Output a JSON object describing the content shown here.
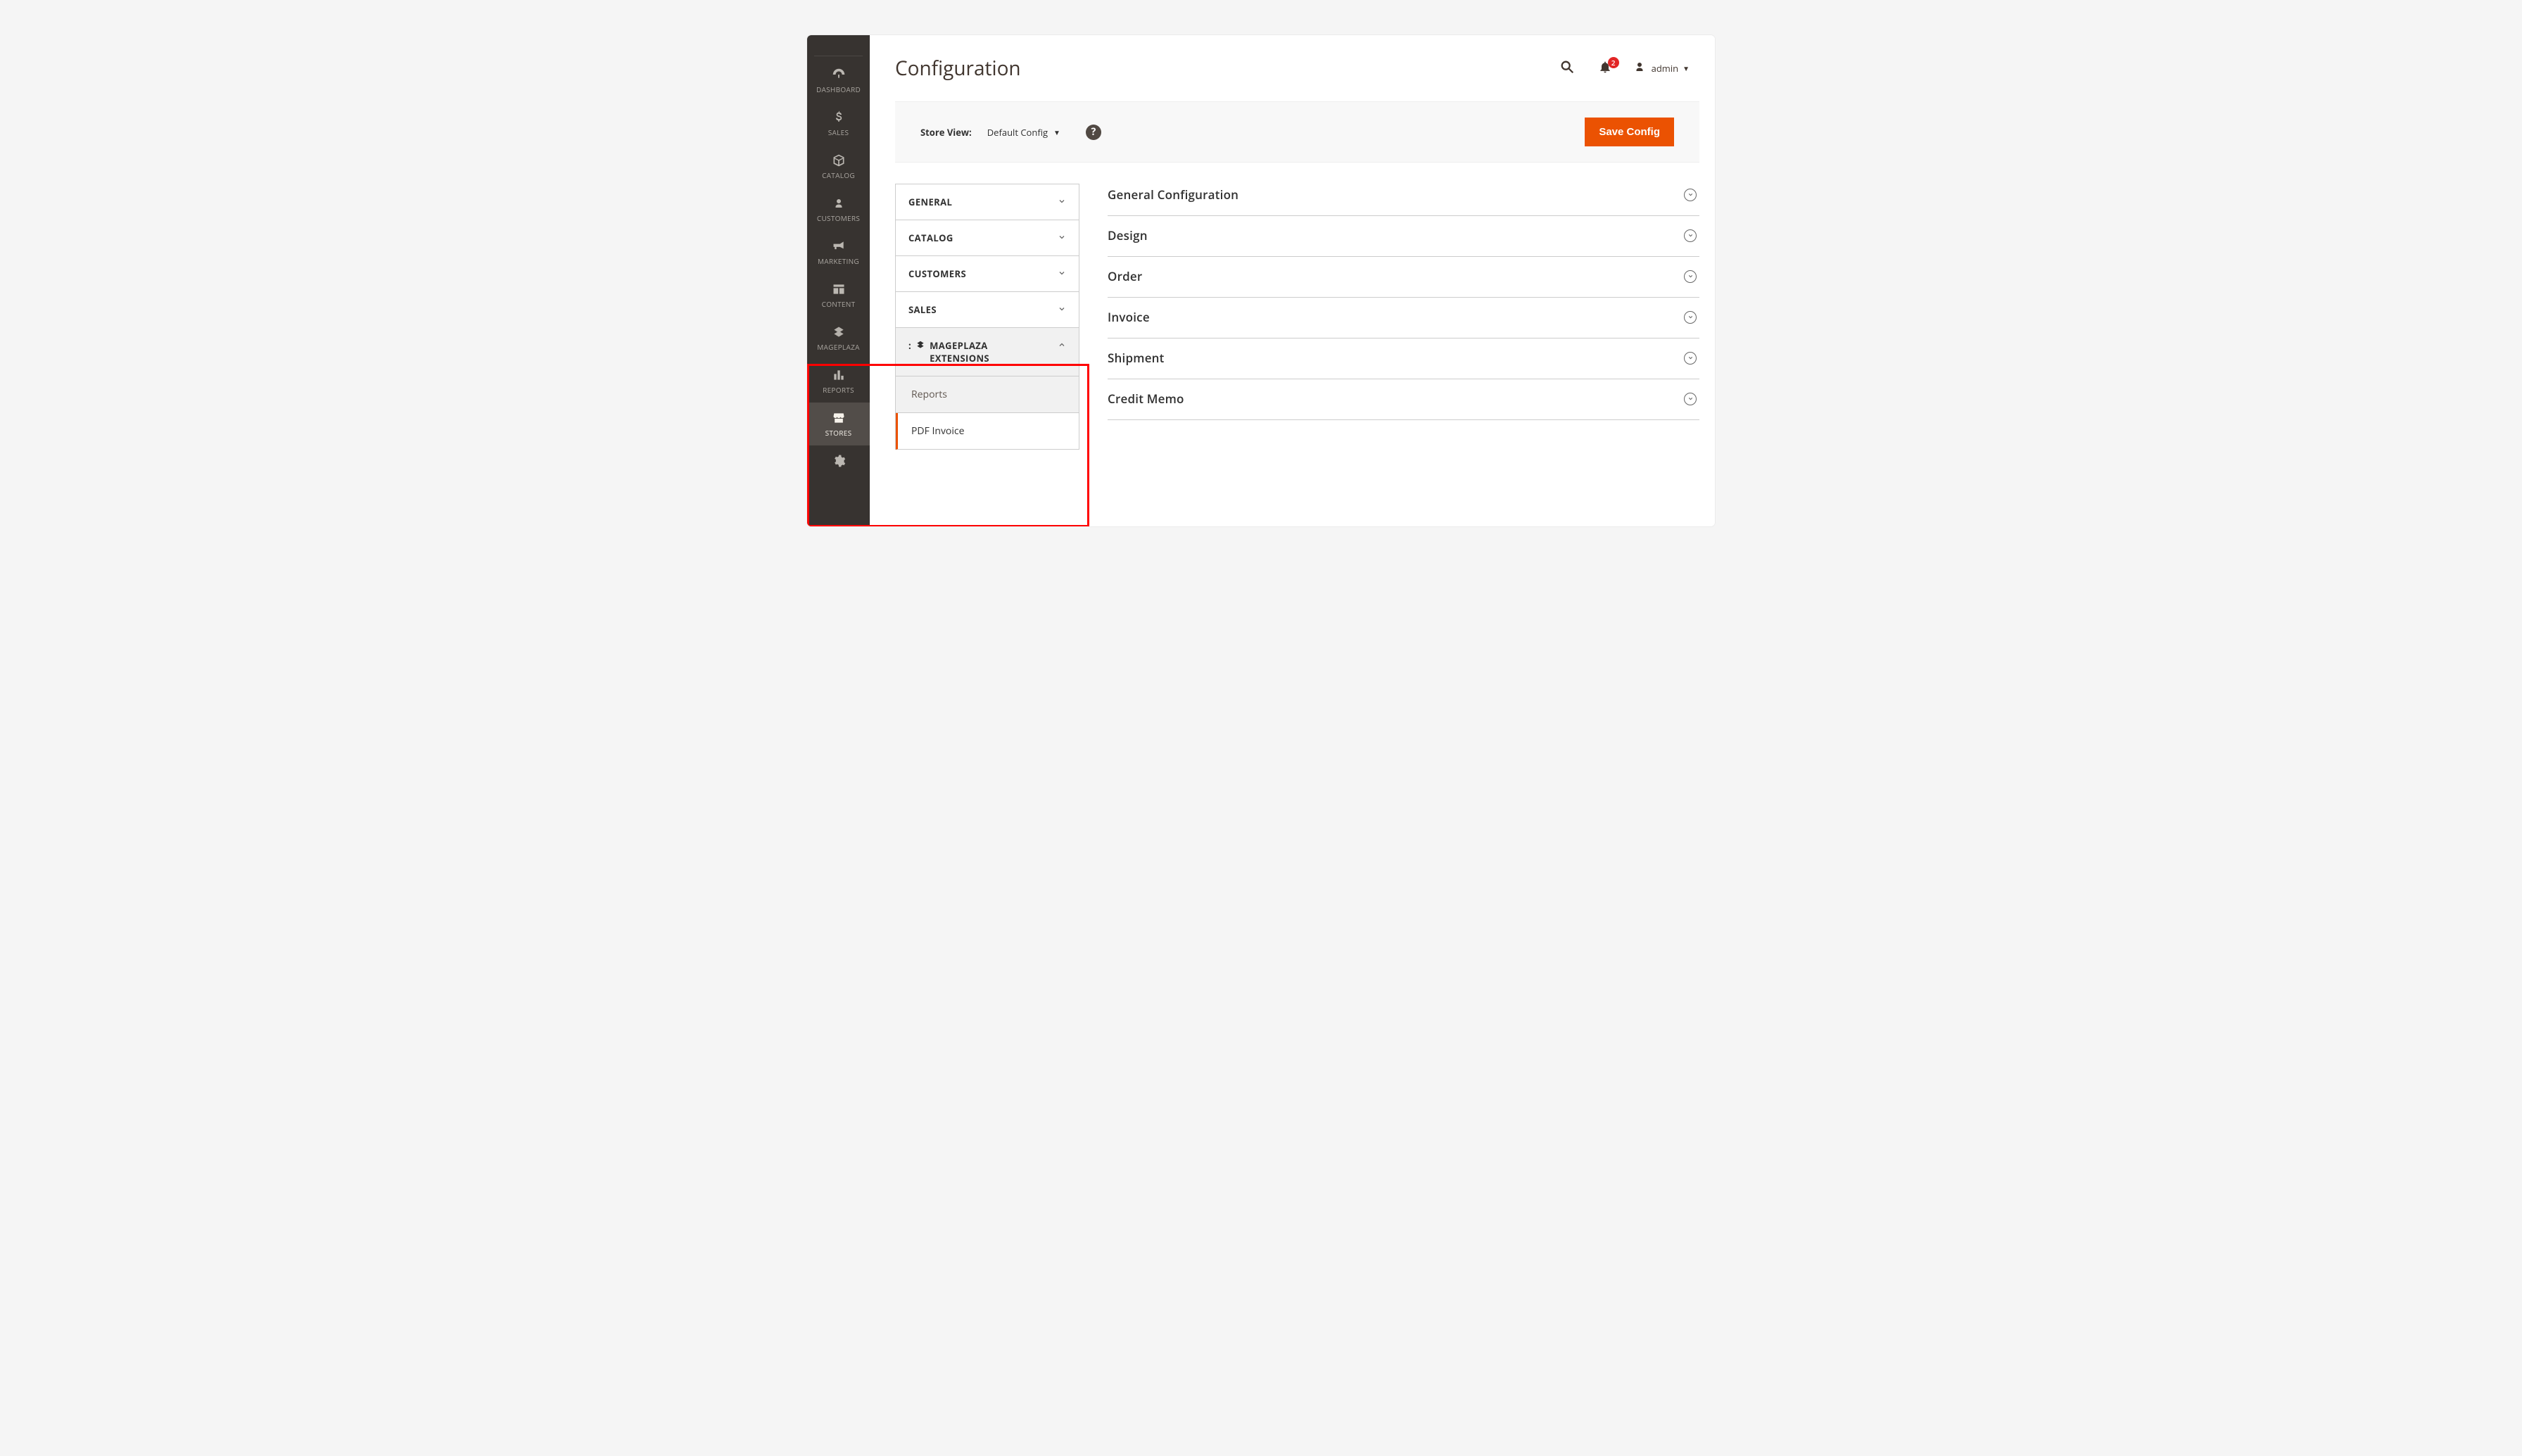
{
  "sidebar": {
    "items": [
      {
        "label": "DASHBOARD"
      },
      {
        "label": "SALES"
      },
      {
        "label": "CATALOG"
      },
      {
        "label": "CUSTOMERS"
      },
      {
        "label": "MARKETING"
      },
      {
        "label": "CONTENT"
      },
      {
        "label": "MAGEPLAZA"
      },
      {
        "label": "REPORTS"
      },
      {
        "label": "STORES"
      }
    ]
  },
  "header": {
    "title": "Configuration",
    "notif_count": "2",
    "user": "admin"
  },
  "toolbar": {
    "store_label": "Store View:",
    "store_value": "Default Config",
    "save_label": "Save Config"
  },
  "config_nav": {
    "items": [
      {
        "label": "GENERAL"
      },
      {
        "label": "CATALOG"
      },
      {
        "label": "CUSTOMERS"
      },
      {
        "label": "SALES"
      },
      {
        "label": "MAGEPLAZA EXTENSIONS"
      }
    ],
    "sub": [
      {
        "label": "Reports"
      },
      {
        "label": "PDF Invoice"
      }
    ]
  },
  "sections": [
    {
      "title": "General Configuration"
    },
    {
      "title": "Design"
    },
    {
      "title": "Order"
    },
    {
      "title": "Invoice"
    },
    {
      "title": "Shipment"
    },
    {
      "title": "Credit Memo"
    }
  ]
}
